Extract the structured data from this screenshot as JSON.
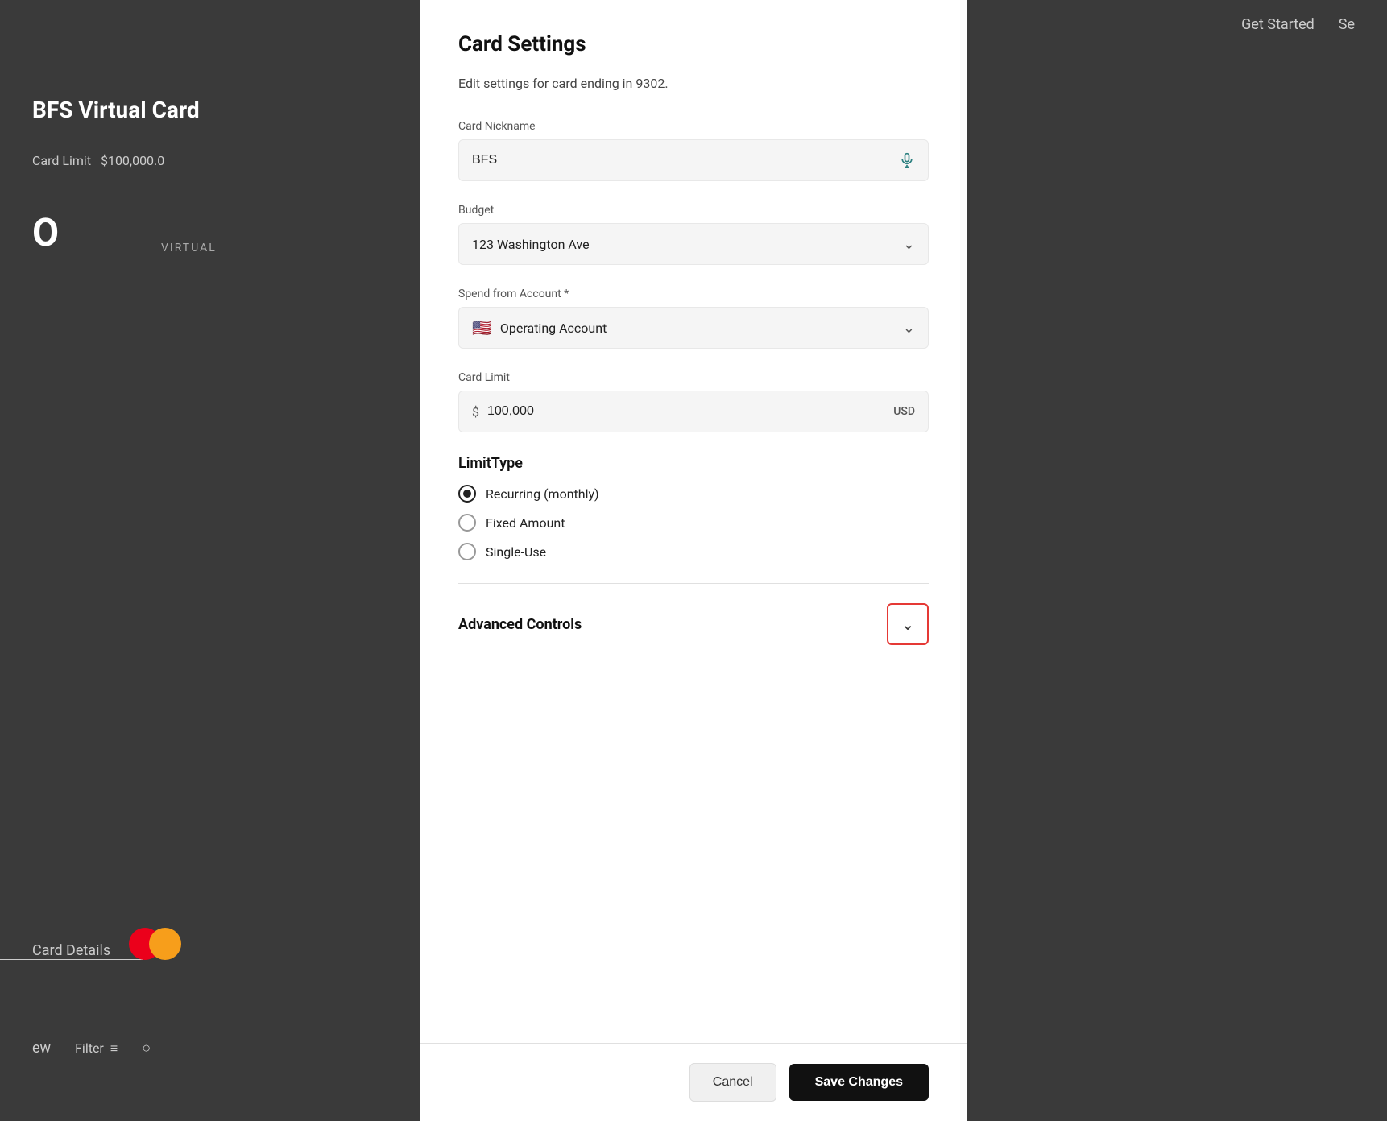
{
  "background": {
    "top_bar": {
      "get_started": "Get Started",
      "search_label": "Se"
    },
    "card": {
      "title": "BFS Virtual Card",
      "card_limit_label": "Card Limit",
      "card_limit_value": "$100,000.0",
      "virtual_label": "VIRTUAL",
      "circle_letter": "O"
    },
    "bottom_bar": {
      "view_label": "ew",
      "filter_label": "Filter"
    }
  },
  "modal": {
    "title": "Card Settings",
    "subtitle": "Edit settings for card ending in 9302.",
    "card_nickname": {
      "label": "Card Nickname",
      "value": "BFS",
      "placeholder": "BFS"
    },
    "budget": {
      "label": "Budget",
      "value": "123 Washington Ave"
    },
    "spend_from_account": {
      "label": "Spend from Account *",
      "value": "Operating Account",
      "flag": "🇺🇸"
    },
    "card_limit": {
      "label": "Card Limit",
      "currency_symbol": "$",
      "value": "100,000",
      "currency": "USD"
    },
    "limit_type": {
      "title": "LimitType",
      "options": [
        {
          "label": "Recurring (monthly)",
          "selected": true
        },
        {
          "label": "Fixed Amount",
          "selected": false
        },
        {
          "label": "Single-Use",
          "selected": false
        }
      ]
    },
    "advanced_controls": {
      "title": "Advanced Controls"
    },
    "footer": {
      "cancel_label": "Cancel",
      "save_label": "Save Changes"
    }
  }
}
